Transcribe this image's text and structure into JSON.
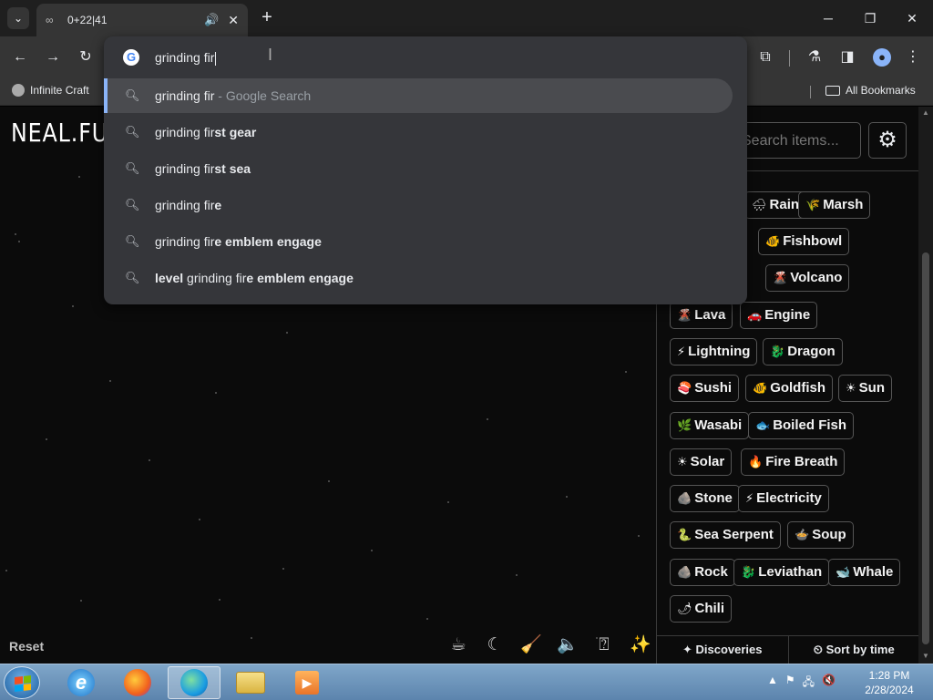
{
  "browser": {
    "tab": {
      "title": "0+22|41",
      "favicon": "infinity-icon"
    },
    "omnibox": {
      "value": "grinding fir",
      "suggestions": [
        {
          "pre": "grinding fir",
          "bold": "",
          "suffix": " - Google Search"
        },
        {
          "pre": "grinding fir",
          "bold": "st gear",
          "suffix": ""
        },
        {
          "pre": "grinding fir",
          "bold": "st sea",
          "suffix": ""
        },
        {
          "pre": "grinding fir",
          "bold": "e",
          "suffix": ""
        },
        {
          "pre": "grinding fir",
          "bold": "e emblem engage",
          "suffix": ""
        },
        {
          "lead": "level",
          "pre": " grinding fir",
          "bold": "e emblem engage",
          "suffix": ""
        }
      ]
    },
    "bookmarks": {
      "first": "Infinite Craft",
      "all": "All Bookmarks"
    }
  },
  "page": {
    "logo": "NEAL.FUN",
    "reset": "Reset",
    "search_placeholder": "Search items...",
    "footer": {
      "discoveries": "Discoveries",
      "sort": "Sort by time"
    },
    "items": [
      {
        "emoji": "🌧",
        "label": "Rain"
      },
      {
        "emoji": "🌾",
        "label": "Marsh"
      },
      {
        "emoji": "🐠",
        "label": "Fishbowl"
      },
      {
        "emoji": "🌋",
        "label": "Volcano"
      },
      {
        "emoji": "🌋",
        "label": "Lava"
      },
      {
        "emoji": "🚗",
        "label": "Engine"
      },
      {
        "emoji": "⚡",
        "label": "Lightning"
      },
      {
        "emoji": "🐉",
        "label": "Dragon"
      },
      {
        "emoji": "🍣",
        "label": "Sushi"
      },
      {
        "emoji": "🐠",
        "label": "Goldfish"
      },
      {
        "emoji": "☀",
        "label": "Sun"
      },
      {
        "emoji": "🌿",
        "label": "Wasabi"
      },
      {
        "emoji": "🐟",
        "label": "Boiled Fish"
      },
      {
        "emoji": "☀",
        "label": "Solar"
      },
      {
        "emoji": "🔥",
        "label": "Fire Breath"
      },
      {
        "emoji": "🪨",
        "label": "Stone"
      },
      {
        "emoji": "⚡",
        "label": "Electricity"
      },
      {
        "emoji": "🐍",
        "label": "Sea Serpent"
      },
      {
        "emoji": "🍲",
        "label": "Soup"
      },
      {
        "emoji": "🪨",
        "label": "Rock"
      },
      {
        "emoji": "🐉",
        "label": "Leviathan"
      },
      {
        "emoji": "🐋",
        "label": "Whale"
      },
      {
        "emoji": "🌶",
        "label": "Chili"
      }
    ]
  },
  "taskbar": {
    "time": "1:28 PM",
    "date": "2/28/2024"
  }
}
